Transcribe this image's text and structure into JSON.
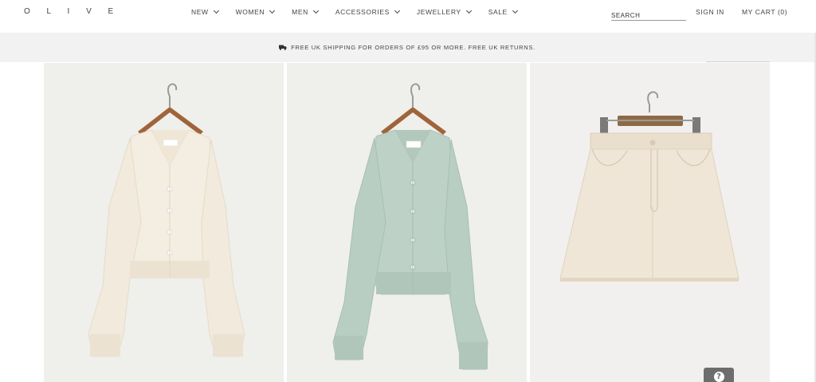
{
  "header": {
    "logo": "O L I V E",
    "nav": [
      {
        "label": "NEW"
      },
      {
        "label": "WOMEN"
      },
      {
        "label": "MEN"
      },
      {
        "label": "ACCESSORIES"
      },
      {
        "label": "JEWELLERY"
      },
      {
        "label": "SALE"
      }
    ],
    "search_placeholder": "SEARCH",
    "sign_in": "SIGN IN",
    "cart": "MY CART (0)"
  },
  "banner": {
    "text": "FREE UK SHIPPING FOR ORDERS OF £95 OR MORE. FREE UK RETURNS.",
    "icon": "truck-icon"
  },
  "products": [
    {
      "name": "cream-cardigan",
      "color": "#f3ece0"
    },
    {
      "name": "sage-cardigan",
      "color": "#bcd0c6"
    },
    {
      "name": "cream-denim-skirt",
      "color": "#efe6d8"
    }
  ],
  "help": {
    "icon": "help-icon",
    "label": "?"
  },
  "colors": {
    "banner_bg": "#f2f2f2",
    "card_bg": "#efefec",
    "help_bg": "#6d6d6d"
  }
}
